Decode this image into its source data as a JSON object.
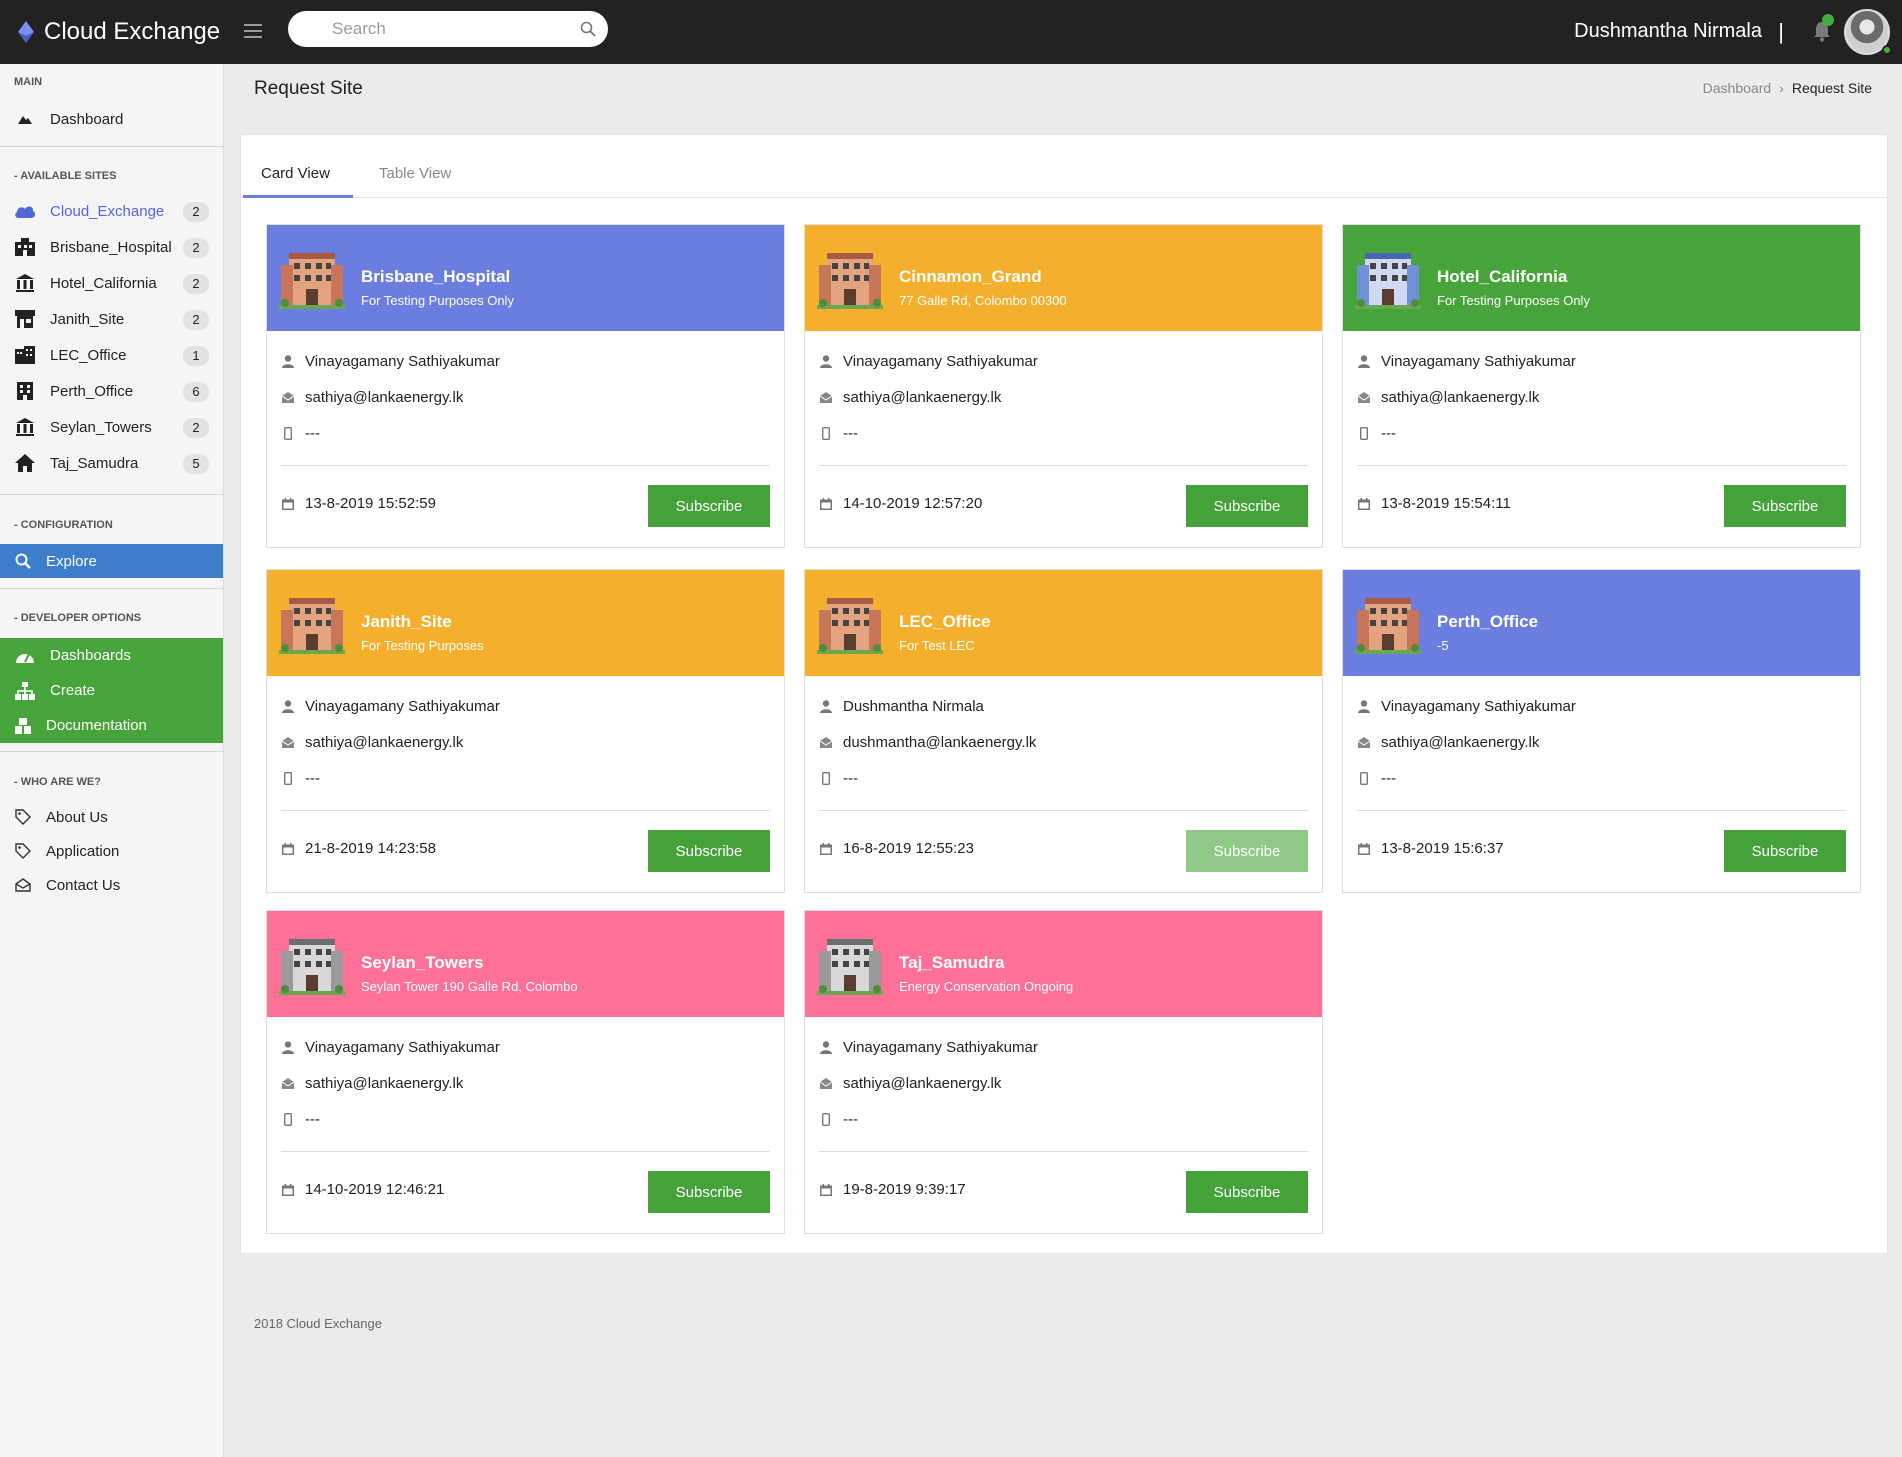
{
  "app": {
    "title": "Cloud Exchange"
  },
  "search": {
    "placeholder": "Search"
  },
  "user": {
    "name": "Dushmantha Nirmala",
    "separator": "|"
  },
  "sidebar": {
    "main_title": "MAIN",
    "dashboard_label": "Dashboard",
    "available_title": "- AVAILABLE SITES",
    "sites": [
      {
        "label": "Cloud_Exchange",
        "count": "2",
        "icon": "cloud-icon"
      },
      {
        "label": "Brisbane_Hospital",
        "count": "2",
        "icon": "building-icon"
      },
      {
        "label": "Hotel_California",
        "count": "2",
        "icon": "institution-icon"
      },
      {
        "label": "Janith_Site",
        "count": "2",
        "icon": "shop-icon"
      },
      {
        "label": "LEC_Office",
        "count": "1",
        "icon": "office-icon"
      },
      {
        "label": "Perth_Office",
        "count": "6",
        "icon": "tower-icon"
      },
      {
        "label": "Seylan_Towers",
        "count": "2",
        "icon": "bank-icon"
      },
      {
        "label": "Taj_Samudra",
        "count": "5",
        "icon": "home-icon"
      }
    ],
    "config_title": "- CONFIGURATION",
    "explore_label": "Explore",
    "dev_title": "- DEVELOPER OPTIONS",
    "dashboards_label": "Dashboards",
    "create_label": "Create",
    "documentation_label": "Documentation",
    "who_title": "- WHO ARE WE?",
    "about_label": "About Us",
    "application_label": "Application",
    "contact_label": "Contact Us"
  },
  "page": {
    "title": "Request Site"
  },
  "breadcrumb": {
    "home": "Dashboard",
    "sep": "›",
    "current": "Request Site"
  },
  "tabs": {
    "card": "Card View",
    "table": "Table View"
  },
  "colors": {
    "blue": "#6b7ee0",
    "orange": "#f4b02d",
    "green": "#47a43b",
    "pink": "#fd7198"
  },
  "cards": [
    {
      "title": "Brisbane_Hospital",
      "subtitle": "For Testing Purposes Only",
      "color": "#6b7ee0",
      "person": "Vinayagamany Sathiyakumar",
      "email": "sathiya@lankaenergy.lk",
      "phone": "---",
      "date": "13-8-2019 15:52:59",
      "button": "Subscribe"
    },
    {
      "title": "Cinnamon_Grand",
      "subtitle": "77 Galle Rd, Colombo 00300",
      "color": "#f4b02d",
      "person": "Vinayagamany Sathiyakumar",
      "email": "sathiya@lankaenergy.lk",
      "phone": "---",
      "date": "14-10-2019 12:57:20",
      "button": "Subscribe"
    },
    {
      "title": "Hotel_California",
      "subtitle": "For Testing Purposes Only",
      "color": "#47a43b",
      "person": "Vinayagamany Sathiyakumar",
      "email": "sathiya@lankaenergy.lk",
      "phone": "---",
      "date": "13-8-2019 15:54:11",
      "button": "Subscribe"
    },
    {
      "title": "Janith_Site",
      "subtitle": "For Testing Purposes",
      "color": "#f4b02d",
      "person": "Vinayagamany Sathiyakumar",
      "email": "sathiya@lankaenergy.lk",
      "phone": "---",
      "date": "21-8-2019 14:23:58",
      "button": "Subscribe"
    },
    {
      "title": "LEC_Office",
      "subtitle": "For Test LEC",
      "color": "#f4b02d",
      "person": "Dushmantha Nirmala",
      "email": "dushmantha@lankaenergy.lk",
      "phone": "---",
      "date": "16-8-2019 12:55:23",
      "button": "Subscribe"
    },
    {
      "title": "Perth_Office",
      "subtitle": "-5",
      "color": "#6b7ee0",
      "person": "Vinayagamany Sathiyakumar",
      "email": "sathiya@lankaenergy.lk",
      "phone": "---",
      "date": "13-8-2019 15:6:37",
      "button": "Subscribe"
    },
    {
      "title": "Seylan_Towers",
      "subtitle": "Seylan Tower 190 Galle Rd, Colombo",
      "color": "#fd7198",
      "person": "Vinayagamany Sathiyakumar",
      "email": "sathiya@lankaenergy.lk",
      "phone": "---",
      "date": "14-10-2019 12:46:21",
      "button": "Subscribe"
    },
    {
      "title": "Taj_Samudra",
      "subtitle": "Energy Conservation Ongoing",
      "color": "#fd7198",
      "person": "Vinayagamany Sathiyakumar",
      "email": "sathiya@lankaenergy.lk",
      "phone": "---",
      "date": "19-8-2019 9:39:17",
      "button": "Subscribe"
    }
  ],
  "footer": {
    "text": "2018 Cloud Exchange"
  }
}
